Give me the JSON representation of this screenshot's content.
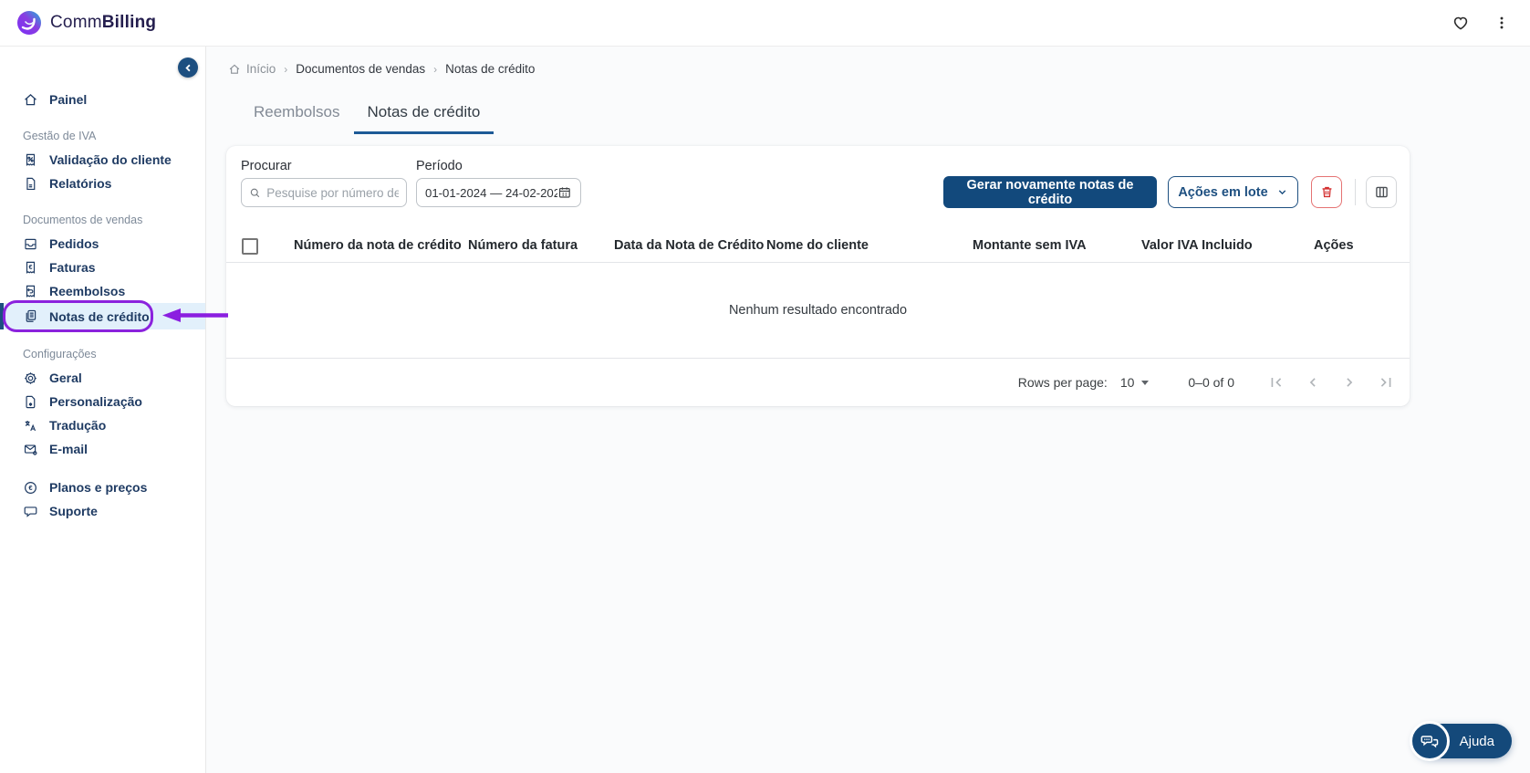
{
  "header": {
    "logo_regular": "Comm",
    "logo_bold": "Billing"
  },
  "sidebar": {
    "primary": {
      "label": "Painel",
      "icon": "home-icon"
    },
    "sections": [
      {
        "title": "Gestão de IVA",
        "items": [
          {
            "label": "Validação do cliente",
            "icon": "vat-validation-icon"
          },
          {
            "label": "Relatórios",
            "icon": "report-icon"
          }
        ]
      },
      {
        "title": "Documentos de vendas",
        "items": [
          {
            "label": "Pedidos",
            "icon": "orders-icon"
          },
          {
            "label": "Faturas",
            "icon": "invoice-icon"
          },
          {
            "label": "Reembolsos",
            "icon": "refund-icon"
          },
          {
            "label": "Notas de crédito",
            "icon": "credit-note-icon",
            "active": true
          }
        ]
      },
      {
        "title": "Configurações",
        "items": [
          {
            "label": "Geral",
            "icon": "gear-icon"
          },
          {
            "label": "Personalização",
            "icon": "customize-icon"
          },
          {
            "label": "Tradução",
            "icon": "translate-icon"
          },
          {
            "label": "E-mail",
            "icon": "email-icon"
          }
        ]
      }
    ],
    "footer_items": [
      {
        "label": "Planos e preços",
        "icon": "euro-circle-icon"
      },
      {
        "label": "Suporte",
        "icon": "support-icon"
      }
    ]
  },
  "breadcrumb": {
    "home": "Início",
    "separator": "›",
    "items": [
      "Documentos de vendas",
      "Notas de crédito"
    ]
  },
  "tabs": [
    {
      "label": "Reembolsos",
      "active": false
    },
    {
      "label": "Notas de crédito",
      "active": true
    }
  ],
  "filters": {
    "search_label": "Procurar",
    "search_placeholder": "Pesquise por número de",
    "period_label": "Período",
    "period_value": "01-01-2024 — 24-02-202"
  },
  "actions": {
    "regenerate_label": "Gerar novamente notas de crédito",
    "bulk_label": "Ações em lote"
  },
  "table": {
    "columns": [
      "Número da nota de crédito",
      "Número da fatura",
      "Data da Nota de Crédito",
      "Nome do cliente",
      "Montante sem IVA",
      "Valor IVA Incluido",
      "Ações"
    ],
    "empty_message": "Nenhum resultado encontrado"
  },
  "pagination": {
    "rows_per_page_label": "Rows per page:",
    "rows_per_page_value": "10",
    "range_label": "0–0 of 0"
  },
  "help": {
    "label": "Ajuda"
  },
  "colors": {
    "primary": "#12497c",
    "active_item_bg": "#e2f0fb",
    "annotation_purple": "#8b22dd",
    "danger": "#d32f2f",
    "tab_underline": "#1d5a96"
  }
}
